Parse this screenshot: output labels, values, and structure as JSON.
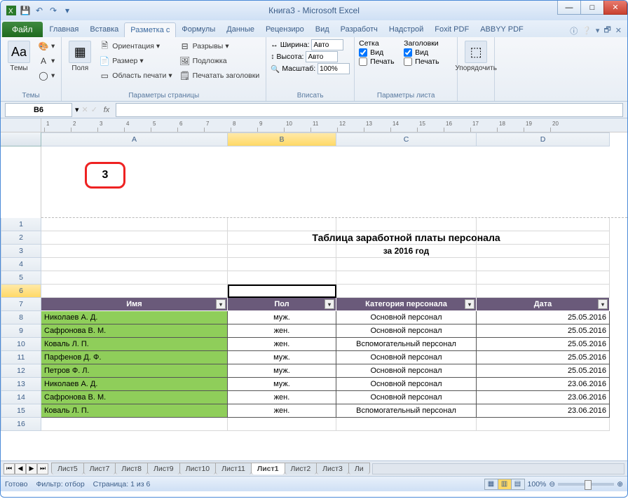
{
  "window": {
    "title": "Книга3 - Microsoft Excel"
  },
  "tabs": {
    "file": "Файл",
    "list": [
      "Главная",
      "Вставка",
      "Разметка с",
      "Формулы",
      "Данные",
      "Рецензиро",
      "Вид",
      "Разработч",
      "Надстрой",
      "Foxit PDF",
      "ABBYY PDF"
    ],
    "active_index": 2
  },
  "ribbon": {
    "themes": {
      "label": "Темы",
      "btn": "Темы"
    },
    "page_setup": {
      "label": "Параметры страницы",
      "margins": "Поля",
      "orientation": "Ориентация",
      "size": "Размер",
      "print_area": "Область печати",
      "breaks": "Разрывы",
      "background": "Подложка",
      "print_titles": "Печатать заголовки"
    },
    "scale": {
      "label": "Вписать",
      "width": "Ширина:",
      "width_val": "Авто",
      "height": "Высота:",
      "height_val": "Авто",
      "scale_lbl": "Масштаб:",
      "scale_val": "100%"
    },
    "sheet_opts": {
      "label": "Параметры листа",
      "gridlines": "Сетка",
      "headings": "Заголовки",
      "view": "Вид",
      "print": "Печать"
    },
    "arrange": {
      "label": "",
      "btn": "Упорядочить"
    }
  },
  "formula": {
    "name_box": "B6",
    "value": ""
  },
  "header_callout": "3",
  "columns": [
    "A",
    "B",
    "C",
    "D"
  ],
  "row_numbers": [
    "1",
    "2",
    "3",
    "4",
    "5",
    "6",
    "7",
    "8",
    "9",
    "10",
    "11",
    "12",
    "13",
    "14",
    "15",
    "16"
  ],
  "title": "Таблица заработной платы персонала",
  "subtitle": "за 2016 год",
  "table": {
    "headers": [
      "Имя",
      "Пол",
      "Категория персонала",
      "Дата"
    ],
    "rows": [
      [
        "Николаев А. Д.",
        "муж.",
        "Основной персонал",
        "25.05.2016"
      ],
      [
        "Сафронова В. М.",
        "жен.",
        "Основной персонал",
        "25.05.2016"
      ],
      [
        "Коваль Л. П.",
        "жен.",
        "Вспомогательный персонал",
        "25.05.2016"
      ],
      [
        "Парфенов Д. Ф.",
        "муж.",
        "Основной персонал",
        "25.05.2016"
      ],
      [
        "Петров Ф. Л.",
        "муж.",
        "Основной персонал",
        "25.05.2016"
      ],
      [
        "Николаев А. Д.",
        "муж.",
        "Основной персонал",
        "23.06.2016"
      ],
      [
        "Сафронова В. М.",
        "жен.",
        "Основной персонал",
        "23.06.2016"
      ],
      [
        "Коваль Л. П.",
        "жен.",
        "Вспомогательный персонал",
        "23.06.2016"
      ]
    ]
  },
  "sheet_tabs": [
    "Лист5",
    "Лист7",
    "Лист8",
    "Лист9",
    "Лист10",
    "Лист11",
    "Лист1",
    "Лист2",
    "Лист3",
    "Ли"
  ],
  "active_sheet_index": 6,
  "status": {
    "ready": "Готово",
    "filter": "Фильтр: отбор",
    "page": "Страница: 1 из 6",
    "zoom": "100%"
  }
}
